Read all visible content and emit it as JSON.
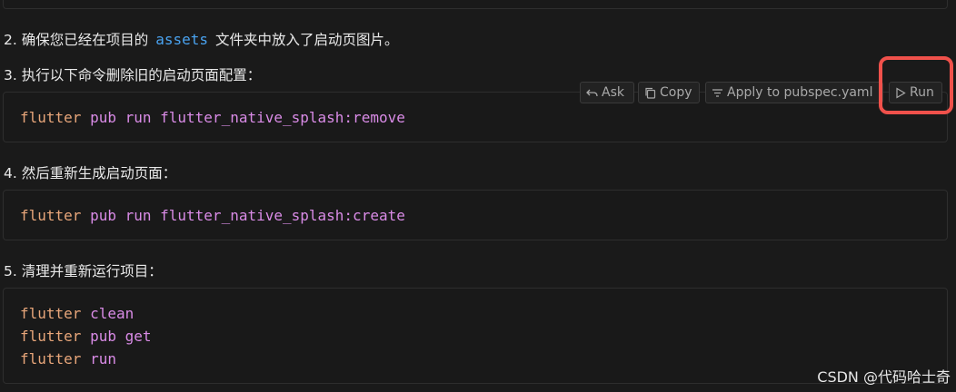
{
  "steps": {
    "step2": {
      "prefix": "2. 确保您已经在项目的",
      "code": "assets",
      "suffix": "文件夹中放入了启动页图片。"
    },
    "step3": "3. 执行以下命令删除旧的启动页面配置：",
    "step4": "4. 然后重新生成启动页面：",
    "step5": "5. 清理并重新运行项目："
  },
  "code_blocks": {
    "remove": {
      "cmd": "flutter",
      "args": " pub run flutter_native_splash:remove"
    },
    "create": {
      "cmd": "flutter",
      "args": " pub run flutter_native_splash:create"
    },
    "run": [
      {
        "cmd": "flutter",
        "args": " clean"
      },
      {
        "cmd": "flutter",
        "args": " pub get"
      },
      {
        "cmd": "flutter",
        "args": " run"
      }
    ]
  },
  "toolbar": {
    "ask_label": "Ask",
    "copy_label": "Copy",
    "apply_label": "Apply to pubspec.yaml",
    "run_label": "Run",
    "icons": [
      "undo-arrow-icon",
      "copy-icon",
      "apply-icon",
      "play-icon"
    ]
  },
  "annotation": {
    "highlight_color": "#f0514b"
  },
  "watermark": "CSDN @代码哈士奇"
}
